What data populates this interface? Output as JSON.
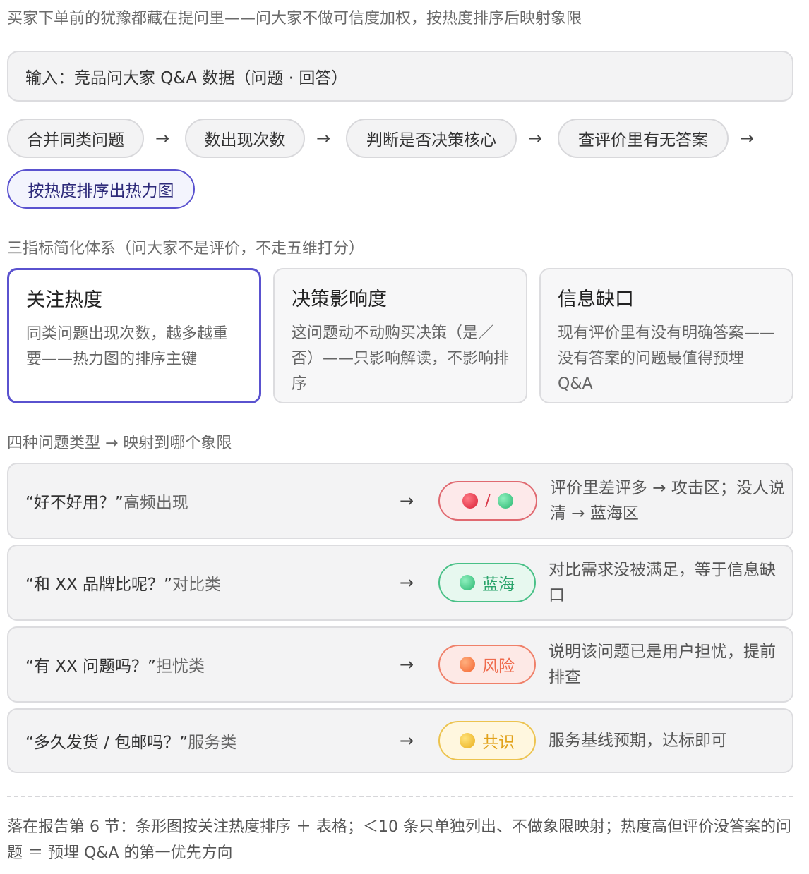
{
  "header": {
    "subtitle": "买家下单前的犹豫都藏在提问里——问大家不做可信度加权，按热度排序后映射象限"
  },
  "input": {
    "label": "输入：竞品问大家 Q&A 数据（问题 · 回答）"
  },
  "flow": {
    "steps": [
      "合并同类问题",
      "数出现次数",
      "判断是否决策核心",
      "查评价里有无答案",
      "按热度排序出热力图"
    ],
    "arrow": "→"
  },
  "metrics_section": {
    "label": "三指标简化体系（问大家不是评价，不走五维打分）",
    "items": [
      {
        "title": "关注热度",
        "desc": "同类问题出现次数，越多越重要——热力图的排序主键"
      },
      {
        "title": "决策影响度",
        "desc": "这问题动不动购买决策（是／否）——只影响解读，不影响排序"
      },
      {
        "title": "信息缺口",
        "desc": "现有评价里有没有明确答案——没有答案的问题最值得预埋 Q&A"
      }
    ]
  },
  "types_section": {
    "label": "四种问题类型 → 映射到哪个象限",
    "rows": [
      {
        "quote": "“好不好用？”",
        "suffix": "高频出现",
        "arrow": "→",
        "pill_label": "/",
        "desc": "评价里差评多 → 攻击区；没人说清 → 蓝海区"
      },
      {
        "quote": "“和 XX 品牌比呢？”",
        "suffix": "对比类",
        "arrow": "→",
        "pill_label": "蓝海",
        "desc": "对比需求没被满足，等于信息缺口"
      },
      {
        "quote": "“有 XX 问题吗？”",
        "suffix": "担忧类",
        "arrow": "→",
        "pill_label": "风险",
        "desc": "说明该问题已是用户担忧，提前排查"
      },
      {
        "quote": "“多久发货 / 包邮吗？”",
        "suffix": "服务类",
        "arrow": "→",
        "pill_label": "共识",
        "desc": "服务基线预期，达标即可"
      }
    ]
  },
  "footer": {
    "text": "落在报告第 6 节：条形图按关注热度排序 ＋ 表格；＜10 条只单独列出、不做象限映射；热度高但评价没答案的问题 ＝ 预埋 Q&A 的第一优先方向"
  },
  "colors": {
    "accent": "#5a52cf",
    "attack": "#d91f36",
    "blue_ocean": "#27b56f",
    "risk": "#f4642f",
    "consensus": "#e9ad1b"
  }
}
